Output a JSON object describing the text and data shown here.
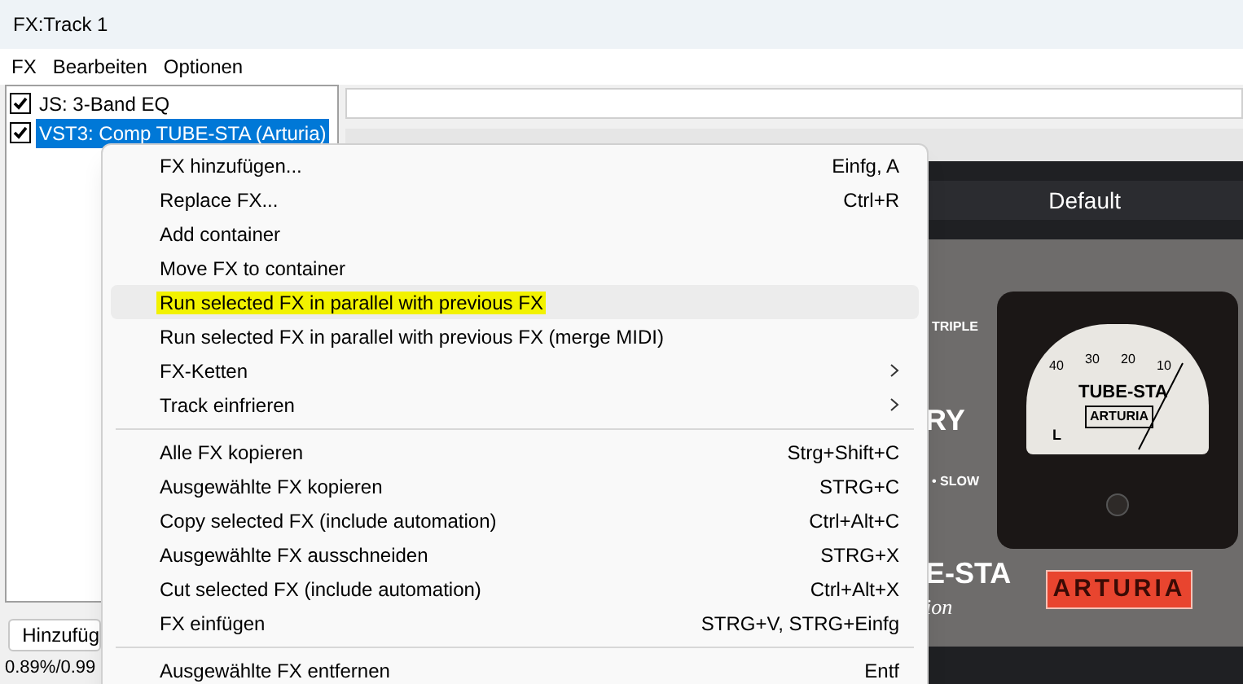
{
  "window": {
    "title": "FX:Track 1"
  },
  "menubar": [
    "FX",
    "Bearbeiten",
    "Optionen"
  ],
  "fx_list": [
    {
      "label": "JS: 3-Band EQ",
      "checked": true,
      "selected": false
    },
    {
      "label": "VST3: Comp TUBE-STA (Arturia)",
      "checked": true,
      "selected": true
    }
  ],
  "add_button": "Hinzufüg",
  "status": "0.89%/0.99",
  "plugin": {
    "preset": "Default",
    "labels": [
      "TRIPLE",
      "RY",
      "• SLOW",
      "E-STA",
      "ion"
    ],
    "meter": {
      "ticks": [
        "40",
        "30",
        "20",
        "10"
      ],
      "name": "TUBE-STA",
      "brand": "ARTURIA",
      "channel": "L"
    },
    "badge": "ARTURIA"
  },
  "context_menu": [
    {
      "kind": "item",
      "label": "FX hinzufügen...",
      "shortcut": "Einfg, A",
      "selected": false,
      "marked": false
    },
    {
      "kind": "item",
      "label": "Replace FX...",
      "shortcut": "Ctrl+R",
      "selected": false,
      "marked": false
    },
    {
      "kind": "item",
      "label": "Add container",
      "selected": false,
      "marked": false
    },
    {
      "kind": "item",
      "label": "Move FX to container",
      "selected": false,
      "marked": false
    },
    {
      "kind": "item",
      "label": "Run selected FX in parallel with previous FX",
      "selected": true,
      "marked": true
    },
    {
      "kind": "item",
      "label": "Run selected FX in parallel with previous FX (merge MIDI)",
      "selected": false,
      "marked": false
    },
    {
      "kind": "submenu",
      "label": "FX-Ketten",
      "selected": false,
      "marked": false
    },
    {
      "kind": "submenu",
      "label": "Track einfrieren",
      "selected": false,
      "marked": false
    },
    {
      "kind": "separator"
    },
    {
      "kind": "item",
      "label": "Alle FX kopieren",
      "shortcut": "Strg+Shift+C",
      "selected": false,
      "marked": false
    },
    {
      "kind": "item",
      "label": "Ausgewählte FX kopieren",
      "shortcut": "STRG+C",
      "selected": false,
      "marked": false
    },
    {
      "kind": "item",
      "label": "Copy selected FX (include automation)",
      "shortcut": "Ctrl+Alt+C",
      "selected": false,
      "marked": false
    },
    {
      "kind": "item",
      "label": "Ausgewählte FX ausschneiden",
      "shortcut": "STRG+X",
      "selected": false,
      "marked": false
    },
    {
      "kind": "item",
      "label": "Cut selected FX (include automation)",
      "shortcut": "Ctrl+Alt+X",
      "selected": false,
      "marked": false
    },
    {
      "kind": "item",
      "label": "FX einfügen",
      "shortcut": "STRG+V, STRG+Einfg",
      "selected": false,
      "marked": false
    },
    {
      "kind": "separator"
    },
    {
      "kind": "item",
      "label": "Ausgewählte FX entfernen",
      "shortcut": "Entf",
      "selected": false,
      "marked": false
    }
  ]
}
